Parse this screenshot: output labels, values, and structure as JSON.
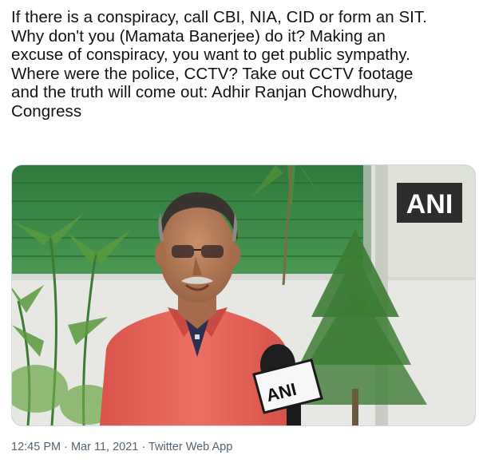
{
  "tweet": {
    "lines": [
      "If there is a conspiracy, call CBI, NIA, CID or form an SIT.",
      "Why don't you (Mamata Banerjee) do it? Making an",
      "excuse of conspiracy, you want to get public sympathy.",
      "Where were the police, CCTV? Take out CCTV footage",
      "and the truth will come out: Adhir Ranjan Chowdhury,",
      "Congress"
    ]
  },
  "media": {
    "watermark": "ANI",
    "mic_logo": "ANI"
  },
  "footer": {
    "time": "12:45 PM",
    "separator": " · ",
    "date": "Mar 11, 2021",
    "app": "Twitter Web App"
  },
  "colors": {
    "text": "#0f1419",
    "muted": "#536471",
    "shirt": "#e8655a",
    "wall_green": "#3f8a4a"
  }
}
